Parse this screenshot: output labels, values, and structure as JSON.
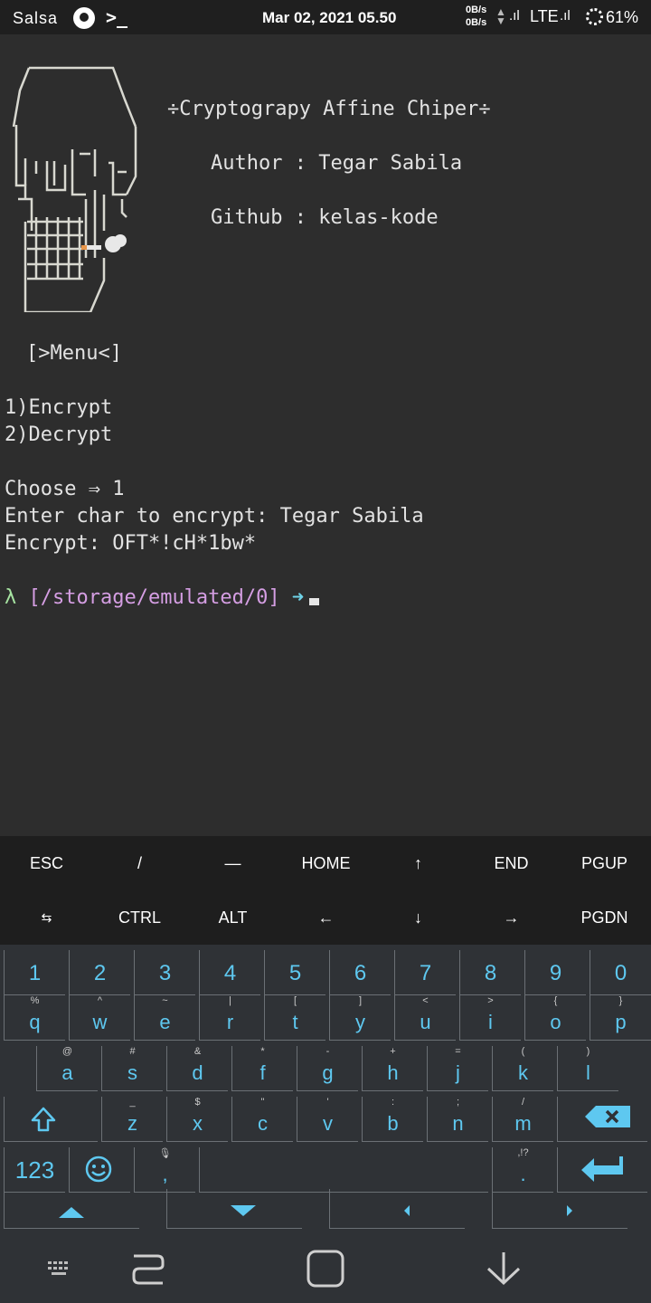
{
  "status_bar": {
    "carrier": "Salsa",
    "datetime": "Mar 02, 2021 05.50",
    "net_up": "0B/s",
    "net_down": "0B/s",
    "network": "LTE",
    "battery": "61%",
    "terminal_glyph": ">_"
  },
  "terminal": {
    "banner_title": "÷Cryptograpy Affine Chiper÷",
    "author_line": "Author : Tegar Sabila",
    "github_line": "Github : kelas-kode",
    "menu_header": "[>Menu<]",
    "menu_items": [
      "1)Encrypt",
      "2)Decrypt"
    ],
    "choose_line": "Choose ⇒ 1",
    "input_line": "Enter char to encrypt: Tegar Sabila",
    "output_line": "Encrypt: OFT*!cH*1bw*",
    "prompt_lambda": "λ",
    "prompt_path": "[/storage/emulated/0]",
    "prompt_arrow": "➜"
  },
  "extra_keys": {
    "row1": [
      "ESC",
      "/",
      "—",
      "HOME",
      "↑",
      "END",
      "PGUP"
    ],
    "row2": [
      "⇆",
      "CTRL",
      "ALT",
      "←",
      "↓",
      "→",
      "PGDN"
    ]
  },
  "keyboard": {
    "numbers": [
      "1",
      "2",
      "3",
      "4",
      "5",
      "6",
      "7",
      "8",
      "9",
      "0"
    ],
    "row_q": [
      {
        "k": "q",
        "s": "%"
      },
      {
        "k": "w",
        "s": "^"
      },
      {
        "k": "e",
        "s": "~"
      },
      {
        "k": "r",
        "s": "|"
      },
      {
        "k": "t",
        "s": "["
      },
      {
        "k": "y",
        "s": "]"
      },
      {
        "k": "u",
        "s": "<"
      },
      {
        "k": "i",
        "s": ">"
      },
      {
        "k": "o",
        "s": "{"
      },
      {
        "k": "p",
        "s": "}"
      }
    ],
    "row_a": [
      {
        "k": "a",
        "s": "@"
      },
      {
        "k": "s",
        "s": "#"
      },
      {
        "k": "d",
        "s": "&"
      },
      {
        "k": "f",
        "s": "*"
      },
      {
        "k": "g",
        "s": "-"
      },
      {
        "k": "h",
        "s": "+"
      },
      {
        "k": "j",
        "s": "="
      },
      {
        "k": "k",
        "s": "("
      },
      {
        "k": "l",
        "s": ")"
      }
    ],
    "row_z": [
      {
        "k": "z",
        "s": "_"
      },
      {
        "k": "x",
        "s": "$"
      },
      {
        "k": "c",
        "s": "\""
      },
      {
        "k": "v",
        "s": "'"
      },
      {
        "k": "b",
        "s": ":"
      },
      {
        "k": "n",
        "s": ";"
      },
      {
        "k": "m",
        "s": "/"
      }
    ],
    "sym_label": "123",
    "comma": ",",
    "period": ".",
    "period_sup": ",!?",
    "accent_color": "#5ec8f0"
  }
}
